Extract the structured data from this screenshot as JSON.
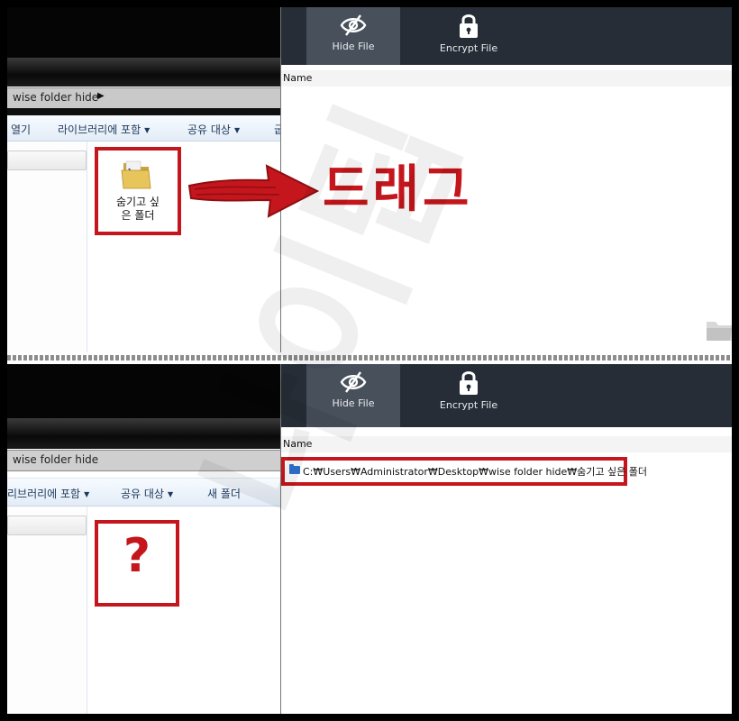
{
  "top_panel": {
    "explorer": {
      "address_path": "wise folder hide",
      "toolbar": [
        "열기",
        "라이브러리에 포함",
        "공유 대상",
        "굽"
      ],
      "file_label_line1": "숨기고 싶",
      "file_label_line2": "은 폴더"
    },
    "app": {
      "tabs": [
        {
          "label": "Hide File",
          "icon": "eye-slash-icon",
          "active": true
        },
        {
          "label": "Encrypt File",
          "icon": "lock-icon",
          "active": false
        }
      ],
      "column_header": "Name"
    },
    "annotation_text": "드래그"
  },
  "bottom_panel": {
    "explorer": {
      "address_path": "wise folder hide",
      "toolbar": [
        "리브러리에 포함",
        "공유 대상",
        "새 폴더"
      ],
      "placeholder_symbol": "?"
    },
    "app": {
      "tabs": [
        {
          "label": "Hide File",
          "icon": "eye-slash-icon",
          "active": true
        },
        {
          "label": "Encrypt File",
          "icon": "lock-icon",
          "active": false
        }
      ],
      "column_header": "Name",
      "hidden_item_path": "C:₩Users₩Administrator₩Desktop₩wise folder hide₩숨기고 싶은 폴더"
    }
  },
  "watermark_text": "나이팁",
  "colors": {
    "annotation_red": "#c4161c",
    "app_header": "#262d36",
    "active_tab": "#47505b",
    "folder_blue": "#2f73d0"
  }
}
